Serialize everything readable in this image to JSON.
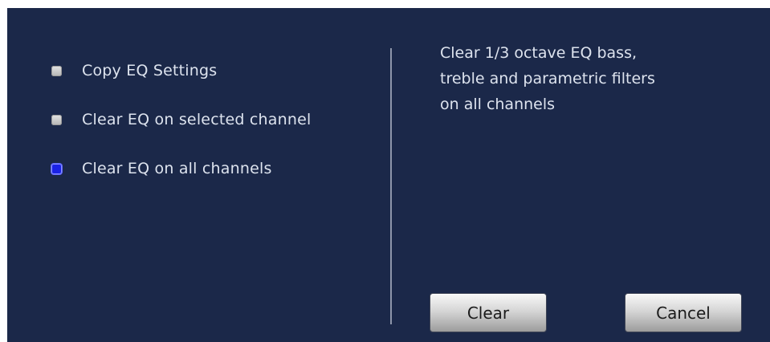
{
  "options": [
    {
      "label": "Copy EQ Settings",
      "selected": false
    },
    {
      "label": "Clear EQ on selected channel",
      "selected": false
    },
    {
      "label": "Clear EQ on all channels",
      "selected": true
    }
  ],
  "description": {
    "lines": [
      "Clear 1/3 octave EQ bass,",
      "treble and parametric filters",
      "on all channels"
    ]
  },
  "buttons": {
    "clear_label": "Clear",
    "cancel_label": "Cancel"
  },
  "colors": {
    "panel_background": "#1b2849",
    "text": "#dde3ee",
    "selected_radio": "#1a22e6",
    "unselected_radio": "#c8c8c8"
  }
}
